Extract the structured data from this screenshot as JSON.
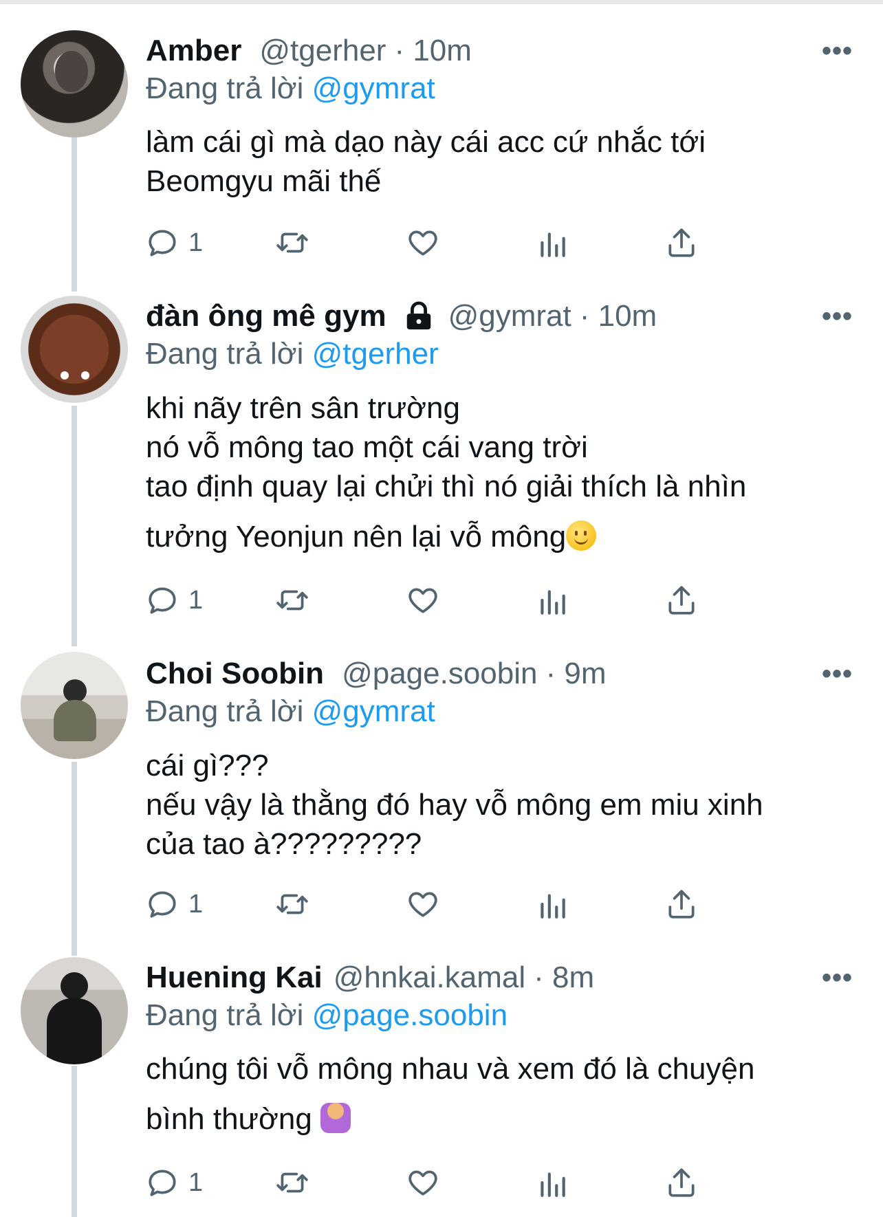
{
  "tweets": [
    {
      "name": "Amber",
      "handle": "@tgerher",
      "time": "· 10m",
      "locked": false,
      "reply_prefix": "Đang trả lời",
      "reply_to": "@gymrat",
      "lines": [
        "làm cái gì mà dạo này cái acc cứ nhắc tới",
        "Beomgyu mãi thế"
      ],
      "reply_count": "1"
    },
    {
      "name": "đàn ông mê gym",
      "handle": "@gymrat",
      "time": "· 10m",
      "locked": true,
      "reply_prefix": "Đang trả lời",
      "reply_to": "@tgerher",
      "lines": [
        "khi nãy trên sân trường",
        "nó vỗ mông tao một cái vang trời",
        "tao định quay lại chửi thì nó giải thích là nhìn",
        "tưởng Yeonjun nên lại vỗ mông"
      ],
      "emoji": "slightly-smiling-face",
      "reply_count": "1"
    },
    {
      "name": "Choi Soobin",
      "handle": "@page.soobin",
      "time": "· 9m",
      "locked": false,
      "reply_prefix": "Đang trả lời",
      "reply_to": "@gymrat",
      "lines": [
        "cái gì???",
        "nếu vậy là thằng đó hay vỗ mông em miu xinh",
        "của tao à?????????"
      ],
      "reply_count": "1"
    },
    {
      "name": "Huening Kai",
      "handle": "@hnkai.kamal",
      "time": "· 8m",
      "locked": false,
      "reply_prefix": "Đang trả lời",
      "reply_to": "@page.soobin",
      "lines": [
        "chúng tôi vỗ mông nhau và xem đó là chuyện",
        "bình thường"
      ],
      "emoji": "person-tipping-hand",
      "reply_count": "1"
    }
  ],
  "more_label": "•••",
  "icons": [
    "reply-icon",
    "retweet-icon",
    "like-icon",
    "analytics-icon",
    "share-icon",
    "lock-icon",
    "more-icon"
  ],
  "colors": {
    "accent": "#1d9bf0",
    "secondary_text": "#536471",
    "thread_line": "#cfd9de"
  }
}
